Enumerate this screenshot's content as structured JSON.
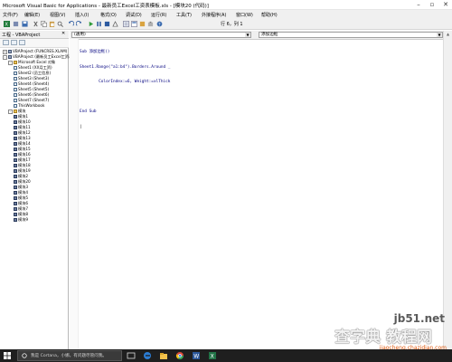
{
  "window": {
    "title": "Microsoft Visual Basic for Applications - 最新员工Excel工资表模板.xls - [模块20 (代码)]",
    "controls": [
      "minimize-icon",
      "restore-icon",
      "close-icon"
    ]
  },
  "menubar": [
    "文件(F)",
    "编辑(E)",
    "视图(V)",
    "插入(I)",
    "格式(O)",
    "调试(D)",
    "运行(R)",
    "工具(T)",
    "外接程序(A)",
    "窗口(W)",
    "帮助(H)"
  ],
  "toolbar": {
    "status": "行 6，列 1"
  },
  "project_pane": {
    "title": "工程 - VBAProject",
    "tree": [
      {
        "label": "VBAProject (FUNCRES.XLAM)",
        "kind": "proj",
        "level": 0,
        "expander": "+"
      },
      {
        "label": "VBAProject (最新员工Excel工资表)",
        "kind": "proj",
        "level": 0,
        "expander": "-"
      },
      {
        "label": "Microsoft Excel 对象",
        "kind": "folder",
        "level": 1,
        "expander": "-"
      },
      {
        "label": "Sheet1 (XX月工资)",
        "kind": "sheet",
        "level": 2
      },
      {
        "label": "Sheet2 (员工信息)",
        "kind": "sheet",
        "level": 2
      },
      {
        "label": "Sheet3 (Sheet3)",
        "kind": "sheet",
        "level": 2
      },
      {
        "label": "Sheet4 (Sheet4)",
        "kind": "sheet",
        "level": 2
      },
      {
        "label": "Sheet5 (Sheet5)",
        "kind": "sheet",
        "level": 2
      },
      {
        "label": "Sheet6 (Sheet6)",
        "kind": "sheet",
        "level": 2
      },
      {
        "label": "Sheet7 (Sheet7)",
        "kind": "sheet",
        "level": 2
      },
      {
        "label": "ThisWorkbook",
        "kind": "sheet",
        "level": 2
      },
      {
        "label": "模块",
        "kind": "folder",
        "level": 1,
        "expander": "-"
      },
      {
        "label": "模块1",
        "kind": "mod",
        "level": 2
      },
      {
        "label": "模块10",
        "kind": "mod",
        "level": 2
      },
      {
        "label": "模块11",
        "kind": "mod",
        "level": 2
      },
      {
        "label": "模块12",
        "kind": "mod",
        "level": 2
      },
      {
        "label": "模块13",
        "kind": "mod",
        "level": 2
      },
      {
        "label": "模块14",
        "kind": "mod",
        "level": 2
      },
      {
        "label": "模块15",
        "kind": "mod",
        "level": 2
      },
      {
        "label": "模块16",
        "kind": "mod",
        "level": 2
      },
      {
        "label": "模块17",
        "kind": "mod",
        "level": 2
      },
      {
        "label": "模块18",
        "kind": "mod",
        "level": 2
      },
      {
        "label": "模块19",
        "kind": "mod",
        "level": 2
      },
      {
        "label": "模块2",
        "kind": "mod",
        "level": 2
      },
      {
        "label": "模块20",
        "kind": "mod",
        "level": 2
      },
      {
        "label": "模块3",
        "kind": "mod",
        "level": 2
      },
      {
        "label": "模块4",
        "kind": "mod",
        "level": 2
      },
      {
        "label": "模块5",
        "kind": "mod",
        "level": 2
      },
      {
        "label": "模块6",
        "kind": "mod",
        "level": 2
      },
      {
        "label": "模块7",
        "kind": "mod",
        "level": 2
      },
      {
        "label": "模块8",
        "kind": "mod",
        "level": 2
      },
      {
        "label": "模块9",
        "kind": "mod",
        "level": 2
      }
    ]
  },
  "code_pane": {
    "object_combo": "(通用)",
    "procedure_combo": "添加边框",
    "lines": [
      "Sub 添加边框()",
      "Sheet1.Range(\"a1:b4\").Borders.Around _",
      "        ColorIndex:=6, Weight:=xlThick",
      "",
      "End Sub",
      "|"
    ]
  },
  "watermark": {
    "site": "jb51.net",
    "big": "查字典 教程网",
    "url": "jiaocheng.chazidian.com"
  },
  "taskbar": {
    "search_text": "我是 Cortana，小娜。有问题尽管问我。",
    "apps": [
      "task-view-icon",
      "edge-icon",
      "explorer-icon",
      "chrome-icon",
      "word-icon",
      "excel-icon"
    ]
  }
}
